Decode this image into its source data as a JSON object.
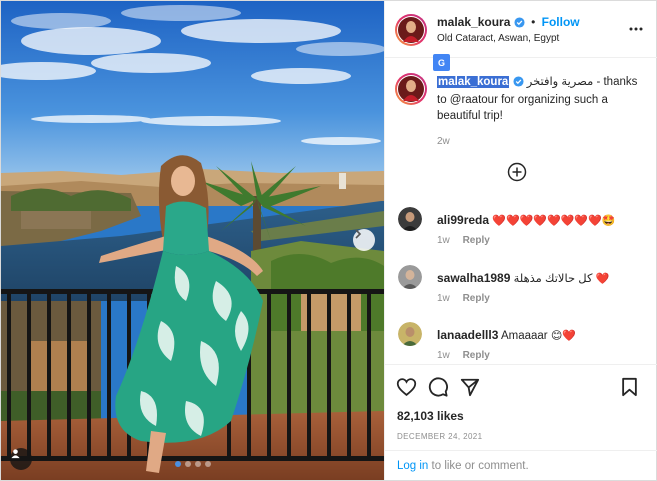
{
  "post": {
    "username": "malak_koura",
    "separator": "•",
    "follow_label": "Follow",
    "location": "Old Cataract, Aswan, Egypt",
    "caption_username": "malak_koura",
    "caption_text": "مصرية وافتخر - thanks to @raatour for organizing such a beautiful trip!",
    "caption_time": "2w",
    "likes": "82,103 likes",
    "date": "DECEMBER 24, 2021",
    "login_link": "Log in",
    "login_rest": " to like or comment."
  },
  "comments": [
    {
      "username": "ali99reda",
      "text": "",
      "emoji": "❤️❤️❤️❤️❤️❤️❤️❤️🤩",
      "time": "1w",
      "reply_label": "Reply"
    },
    {
      "username": "sawalha1989",
      "text": "كل حالاتك مذهلة",
      "emoji": "❤️",
      "time": "1w",
      "reply_label": "Reply"
    },
    {
      "username": "lanaadelll3",
      "text": "Amaaaar",
      "emoji": "😊❤️",
      "time": "1w",
      "reply_label": "Reply"
    }
  ],
  "icons": {
    "verified": "verified-badge-icon",
    "more": "more-options-icon",
    "heart": "heart-icon",
    "comment": "comment-icon",
    "share": "share-icon",
    "save": "bookmark-icon",
    "next": "next-arrow-icon",
    "tag": "user-tag-icon",
    "plus": "load-more-icon",
    "translate": "translate-icon"
  },
  "colors": {
    "accent": "#0095f6",
    "text": "#262626",
    "muted": "#8e8e8e",
    "border": "#efefef",
    "heart_red": "#ed1b2e",
    "highlight": "#3b6fd4"
  },
  "carousel": {
    "count": 4,
    "active_index": 0
  }
}
